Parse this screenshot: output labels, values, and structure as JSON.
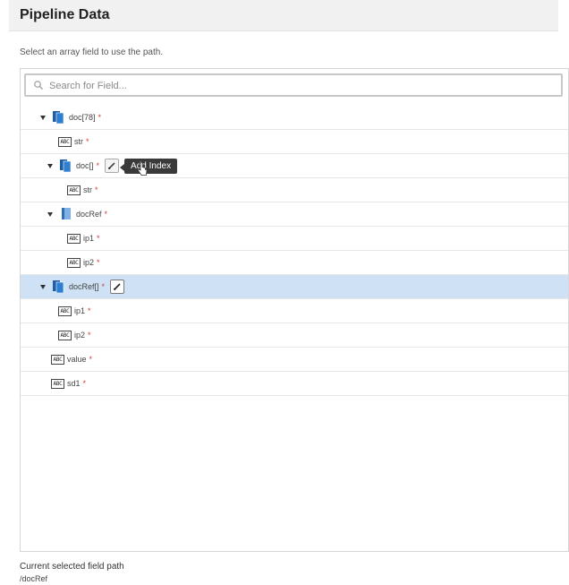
{
  "header": {
    "title": "Pipeline Data"
  },
  "instruction": "Select an array field to use the path.",
  "search": {
    "placeholder": "Search for Field..."
  },
  "tree": {
    "required_mark": "*",
    "string_icon_text": "ABC",
    "rows": [
      {
        "label": "doc[78]"
      },
      {
        "label": "str"
      },
      {
        "label": "doc[]"
      },
      {
        "label": "str"
      },
      {
        "label": "docRef"
      },
      {
        "label": "ip1"
      },
      {
        "label": "ip2"
      },
      {
        "label": "docRef[]"
      },
      {
        "label": "ip1"
      },
      {
        "label": "ip2"
      },
      {
        "label": "value"
      },
      {
        "label": "sd1"
      }
    ]
  },
  "tooltip": {
    "text": "Add Index"
  },
  "footer": {
    "label": "Current selected field path",
    "path": "/docRef"
  },
  "icons": {
    "array_document": "document-array-icon",
    "document": "document-icon",
    "string": "string-field-icon",
    "edit": "pencil-icon",
    "search": "search-icon",
    "expand": "caret-down-icon",
    "cursor": "hand-cursor-icon"
  },
  "colors": {
    "selected_row": "#cfe2f5",
    "required": "#d04040",
    "array_icon": "#1f5fa8",
    "tooltip_bg": "#3a3a3a"
  }
}
